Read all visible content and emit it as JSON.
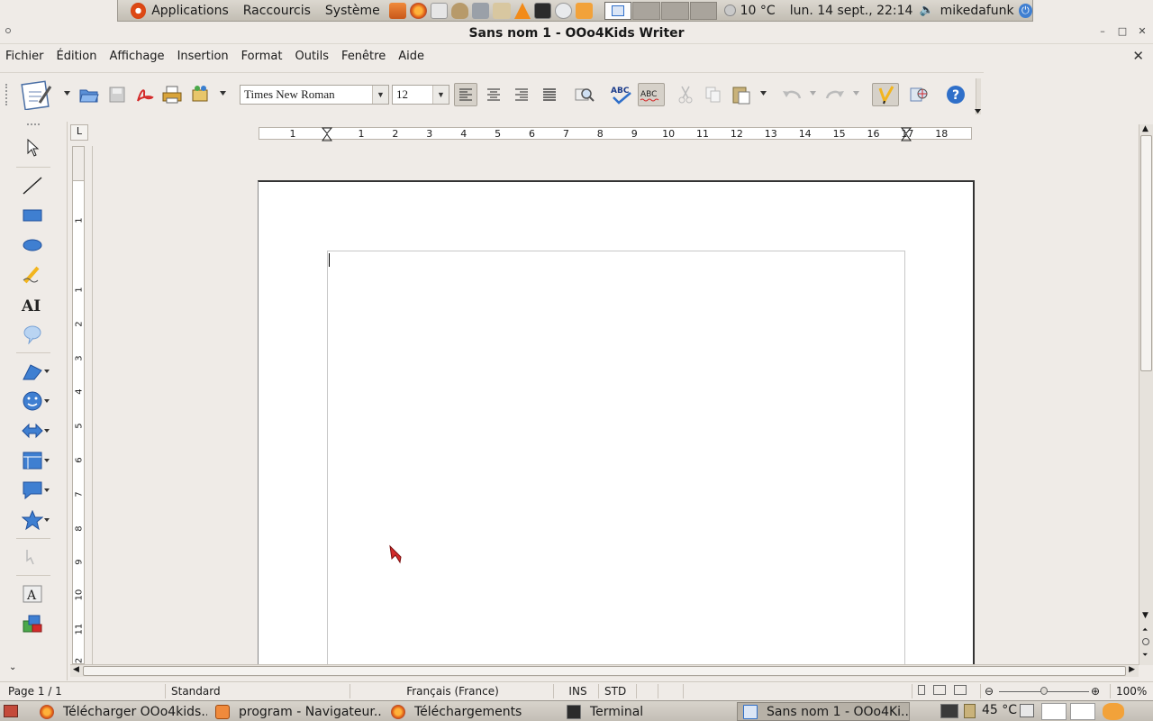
{
  "top_panel": {
    "menus": [
      "Applications",
      "Raccourcis",
      "Système"
    ],
    "launchers": [
      "home-folder-icon",
      "firefox-icon",
      "mail-icon",
      "teapot-icon",
      "media-player-icon",
      "file-icon",
      "vlc-icon",
      "terminal-icon",
      "disk-icon",
      "pointer-icon"
    ],
    "weather": "10 °C",
    "clock": "lun. 14 sept., 22:14",
    "user": "mikedafunk"
  },
  "window": {
    "title": "Sans nom 1 - OOo4Kids Writer"
  },
  "menubar": {
    "items": [
      "Fichier",
      "Édition",
      "Affichage",
      "Insertion",
      "Format",
      "Outils",
      "Fenêtre",
      "Aide"
    ]
  },
  "toolbar": {
    "font_name": "Times New Roman",
    "font_size": "12"
  },
  "ruler": {
    "h_labels": [
      "1",
      "1",
      "2",
      "3",
      "4",
      "5",
      "6",
      "7",
      "8",
      "9",
      "10",
      "11",
      "12",
      "13",
      "14",
      "15",
      "16",
      "17",
      "18"
    ],
    "v_labels": [
      "1",
      "1",
      "2",
      "3",
      "4",
      "5",
      "6",
      "7",
      "8",
      "9",
      "10",
      "11",
      "12"
    ],
    "corner": "L"
  },
  "statusbar": {
    "page": "Page 1 / 1",
    "style": "Standard",
    "language": "Français (France)",
    "insert_mode": "INS",
    "selection_mode": "STD",
    "zoom": "100%",
    "zoom_fraction": 0.5
  },
  "taskbar": {
    "tasks": [
      {
        "label": "Télécharger OOo4kids...",
        "icon": "firefox-icon"
      },
      {
        "label": "program - Navigateur...",
        "icon": "file-browser-icon"
      },
      {
        "label": "Téléchargements",
        "icon": "firefox-icon"
      },
      {
        "label": "Terminal",
        "icon": "terminal-icon"
      },
      {
        "label": "Sans nom 1 - OOo4Ki...",
        "icon": "writer-icon"
      }
    ],
    "temperature": "45 °C"
  },
  "colors": {
    "accent_blue": "#2f6fc9",
    "ubuntu_orange": "#dd4814",
    "window_bg": "#efebe7"
  }
}
